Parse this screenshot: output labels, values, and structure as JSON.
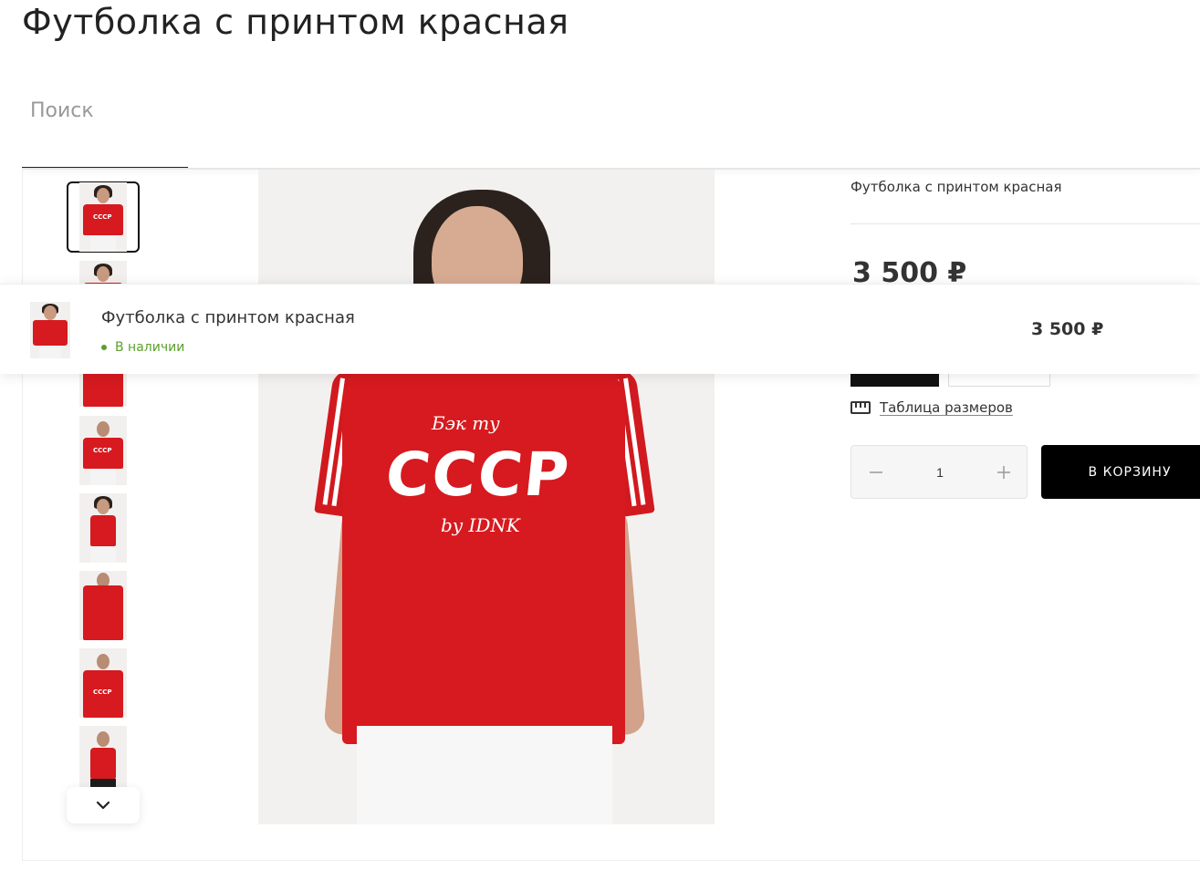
{
  "page": {
    "title": "Футболка с принтом красная"
  },
  "search": {
    "placeholder": "Поиск",
    "value": ""
  },
  "gallery": {
    "thumbnails": [
      {
        "name": "thumb-1",
        "active": true
      },
      {
        "name": "thumb-2",
        "active": false
      },
      {
        "name": "thumb-3",
        "active": false
      },
      {
        "name": "thumb-4",
        "active": false
      },
      {
        "name": "thumb-5",
        "active": false
      },
      {
        "name": "thumb-6",
        "active": false
      },
      {
        "name": "thumb-7",
        "active": false
      },
      {
        "name": "thumb-8",
        "active": false
      }
    ],
    "scroll_icon": "chevron-down-icon",
    "main_print": {
      "top_line": "Бэк ту",
      "main_line": "СССР",
      "bottom_line": "by IDNK"
    }
  },
  "product": {
    "name": "Футболка с принтом красная",
    "price": "3 500 ₽",
    "size_table_icon": "ruler-icon",
    "size_table_label": "Таблица размеров",
    "quantity": {
      "value": "1",
      "minus_icon": "minus-icon",
      "plus_icon": "plus-icon"
    },
    "cart_button_label": "В КОРЗИНУ"
  },
  "sticky_bar": {
    "name": "Футболка с принтом красная",
    "stock_label": "В наличии",
    "price": "3 500 ₽"
  },
  "colors": {
    "accent": "#000000",
    "product_red": "#d61a1f",
    "in_stock": "#5aa02c"
  }
}
